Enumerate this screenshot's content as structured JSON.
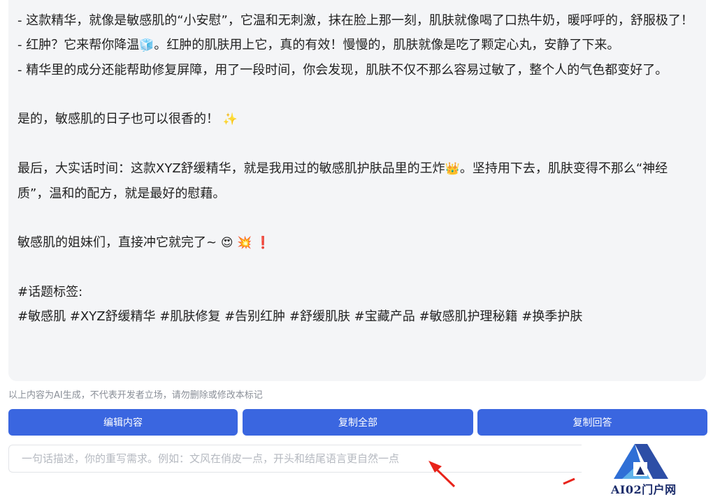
{
  "message": {
    "lines": [
      "- 这款精华，就像是敏感肌的“小安慰”，它温和无刺激，抹在脸上那一刻，肌肤就像喝了口热牛奶，暖呼呼的，舒服极了！",
      "- 红肿？它来帮你降温",
      "🧊",
      "。红肿的肌肤用上它，真的有效！慢慢的，肌肤就像是吃了颗定心丸，安静了下来。",
      "- 精华里的成分还能帮助修复屏障，用了一段时间，你会发现，肌肤不仅不那么容易过敏了，整个人的气色都变好了。",
      "是的，敏感肌的日子也可以很香的！",
      "✨",
      "最后，大实话时间：这款XYZ舒缓精华，就是我用过的敏感肌护肤品里的王炸",
      "👑",
      "。坚持用下去，肌肤变得不那么“神经质”，温和的配方，就是最好的慰藉。",
      "敏感肌的姐妹们，直接冲它就完了~ ",
      "😍 💥 ❗",
      "#话题标签:",
      "#敏感肌 #XYZ舒缓精华 #肌肤修复 #告别红肿 #舒缓肌肤 #宝藏产品 #敏感肌护理秘籍 #换季护肤"
    ]
  },
  "disclaimer": "以上内容为AI生成，不代表开发者立场，请勿删除或修改本标记",
  "buttons": {
    "edit": "编辑内容",
    "copy_all": "复制全部",
    "copy_answer": "复制回答"
  },
  "rewrite": {
    "value": "",
    "placeholder": "一句话描述，你的重写需求。例如：文风在俏皮一点，开头和结尾语言更自然一点"
  },
  "watermark": {
    "text": "AI02门户网"
  },
  "colors": {
    "button": "#3a66e0",
    "bubble": "#f4f5f7",
    "annotation_arrow": "#e8231a"
  }
}
